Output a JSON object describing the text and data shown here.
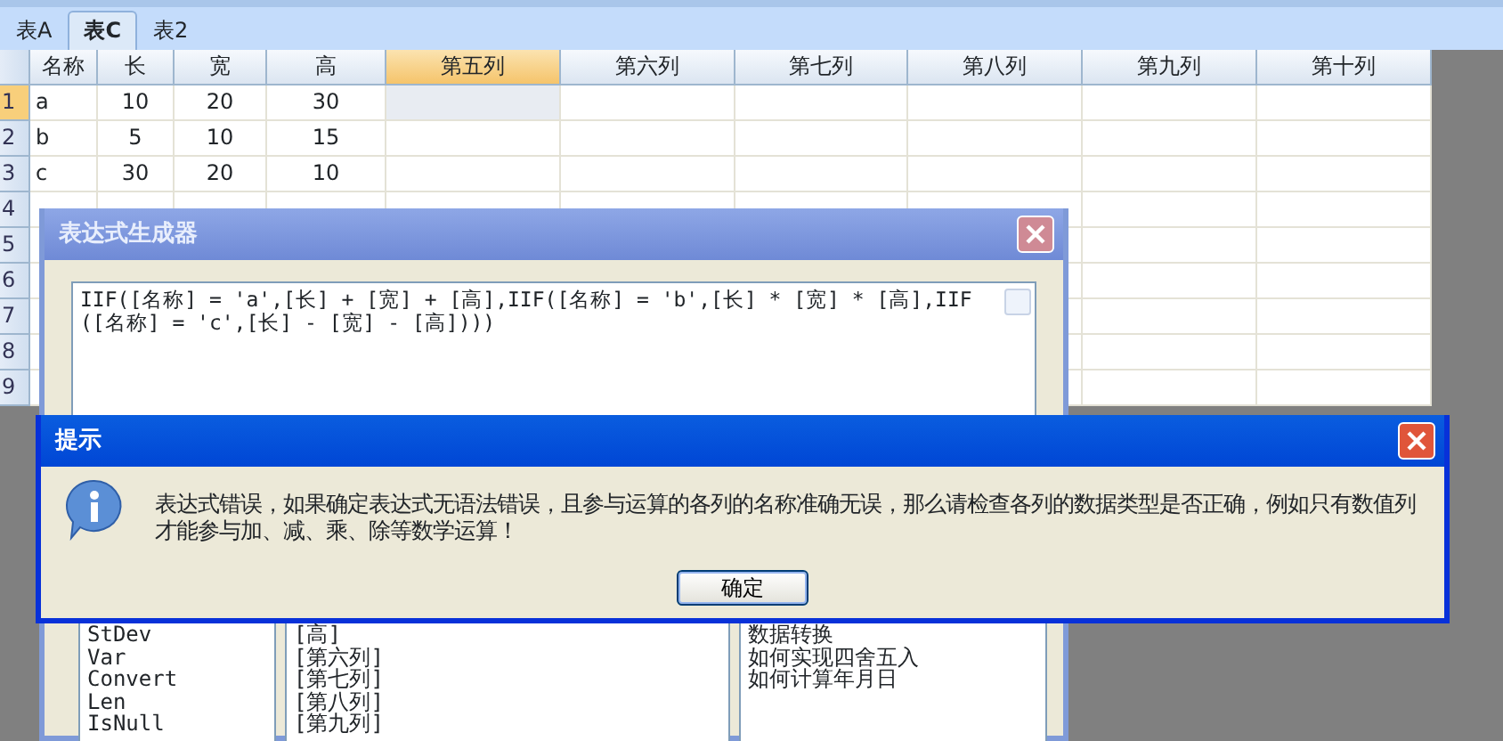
{
  "sheet_tabs": [
    {
      "label": "表A",
      "selected": false
    },
    {
      "label": "表C",
      "selected": true
    },
    {
      "label": "表2",
      "selected": false
    }
  ],
  "grid": {
    "columns": [
      {
        "label": "名称",
        "selected": false
      },
      {
        "label": "长",
        "selected": false
      },
      {
        "label": "宽",
        "selected": false
      },
      {
        "label": "高",
        "selected": false
      },
      {
        "label": "第五列",
        "selected": true
      },
      {
        "label": "第六列",
        "selected": false
      },
      {
        "label": "第七列",
        "selected": false
      },
      {
        "label": "第八列",
        "selected": false
      },
      {
        "label": "第九列",
        "selected": false
      },
      {
        "label": "第十列",
        "selected": false
      }
    ],
    "rows": [
      {
        "label": "1",
        "selected": true,
        "cells": [
          "a",
          "10",
          "20",
          "30"
        ]
      },
      {
        "label": "2",
        "selected": false,
        "cells": [
          "b",
          "5",
          "10",
          "15"
        ]
      },
      {
        "label": "3",
        "selected": false,
        "cells": [
          "c",
          "30",
          "20",
          "10"
        ]
      },
      {
        "label": "4",
        "selected": false,
        "cells": []
      },
      {
        "label": "5",
        "selected": false,
        "cells": []
      },
      {
        "label": "6",
        "selected": false,
        "cells": []
      },
      {
        "label": "7",
        "selected": false,
        "cells": []
      },
      {
        "label": "8",
        "selected": false,
        "cells": []
      },
      {
        "label": "9",
        "selected": false,
        "cells": []
      }
    ]
  },
  "expression_dialog": {
    "title": "表达式生成器",
    "expression": "IIF([名称] = 'a',[长] + [宽] + [高],IIF([名称] = 'b',[长] * [宽] * [高],IIF([名称] = 'c',[长] - [宽] - [高])))",
    "functions": [
      "StDev",
      "Var",
      "Convert",
      "Len",
      "IsNull"
    ],
    "fields": [
      "[高]",
      "[第六列]",
      "[第七列]",
      "[第八列]",
      "[第九列]"
    ],
    "help_topics": [
      "数据转换",
      "如何实现四舍五入",
      "如何计算年月日"
    ]
  },
  "message_box": {
    "title": "提示",
    "message": "表达式错误，如果确定表达式无语法错误，且参与运算的各列的名称准确无误，那么请检查各列的数据类型是否正确，例如只有数值列才能参与加、减、乘、除等数学运算！",
    "button": "确定"
  }
}
